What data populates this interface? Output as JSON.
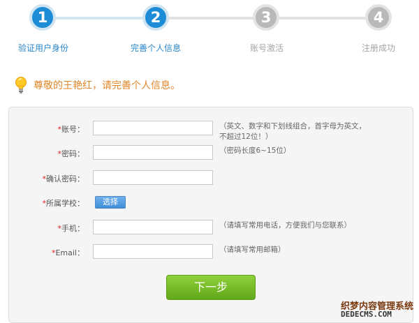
{
  "steps": [
    {
      "number": "1",
      "label": "验证用户身份",
      "state": "done"
    },
    {
      "number": "2",
      "label": "完善个人信息",
      "state": "active"
    },
    {
      "number": "3",
      "label": "账号激活",
      "state": "pending"
    },
    {
      "number": "4",
      "label": "注册成功",
      "state": "pending"
    }
  ],
  "greeting": {
    "text": "尊敬的王艳红，请完善个人信息。",
    "icon": "lightbulb-icon"
  },
  "form": {
    "required_mark": "*",
    "account": {
      "label": "账号：",
      "value": "",
      "hint": "（英文、数字和下划线组合，首字母为英文，不超过12位！）"
    },
    "password": {
      "label": "密码：",
      "value": "",
      "hint": "（密码长度6~15位）"
    },
    "confirm_password": {
      "label": "确认密码：",
      "value": ""
    },
    "school": {
      "label": "所属学校：",
      "button": "选择"
    },
    "phone": {
      "label": "手机：",
      "value": "",
      "hint": "（请填写常用电话，方便我们与您联系）"
    },
    "email": {
      "label": "Email：",
      "value": "",
      "hint": "（请填写常用邮箱）"
    },
    "next_button": "下一步"
  },
  "watermark": {
    "line1": "织梦内容管理系统",
    "line2": "DEDECMS.COM"
  },
  "colors": {
    "accent_blue": "#1d8cd6",
    "greeting_orange": "#e0862a",
    "button_green": "#62a81b",
    "required_red": "#e02020"
  }
}
